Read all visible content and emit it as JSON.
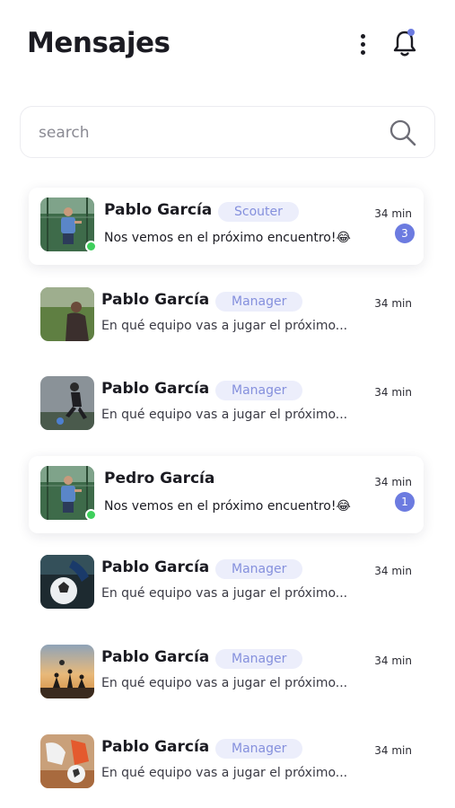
{
  "header": {
    "title": "Mensajes",
    "more_icon": "more-vertical-icon",
    "bell_icon": "bell-icon"
  },
  "search": {
    "placeholder": "search",
    "icon": "search-icon"
  },
  "colors": {
    "accent": "#6c7be0",
    "tag_bg": "#eceefb",
    "tag_text": "#8590dd",
    "online": "#3ecf5c"
  },
  "chats": [
    {
      "name": "Pablo García",
      "role": "Scouter",
      "time": "34 min",
      "preview": "Nos vemos en el próximo encuentro!😂",
      "unread": "3",
      "online": true,
      "highlight": true,
      "photo": "tennis-court"
    },
    {
      "name": "Pablo García",
      "role": "Manager",
      "time": "34 min",
      "preview": "En qué equipo vas a jugar el próximo...",
      "unread": "",
      "online": false,
      "highlight": false,
      "photo": "field"
    },
    {
      "name": "Pablo García",
      "role": "Manager",
      "time": "34 min",
      "preview": "En qué equipo vas a jugar el próximo...",
      "unread": "",
      "online": false,
      "highlight": false,
      "photo": "kick"
    },
    {
      "name": "Pedro García",
      "role": "",
      "time": "34 min",
      "preview": "Nos vemos en el próximo encuentro!😂",
      "unread": "1",
      "online": true,
      "highlight": true,
      "photo": "tennis-court"
    },
    {
      "name": "Pablo García",
      "role": "Manager",
      "time": "34 min",
      "preview": "En qué equipo vas a jugar el próximo...",
      "unread": "",
      "online": false,
      "highlight": false,
      "photo": "ball"
    },
    {
      "name": "Pablo García",
      "role": "Manager",
      "time": "34 min",
      "preview": "En qué equipo vas a jugar el próximo...",
      "unread": "",
      "online": false,
      "highlight": false,
      "photo": "sunset"
    },
    {
      "name": "Pablo García",
      "role": "Manager",
      "time": "34 min",
      "preview": "En qué equipo vas a jugar el próximo...",
      "unread": "",
      "online": false,
      "highlight": false,
      "photo": "boots"
    }
  ]
}
